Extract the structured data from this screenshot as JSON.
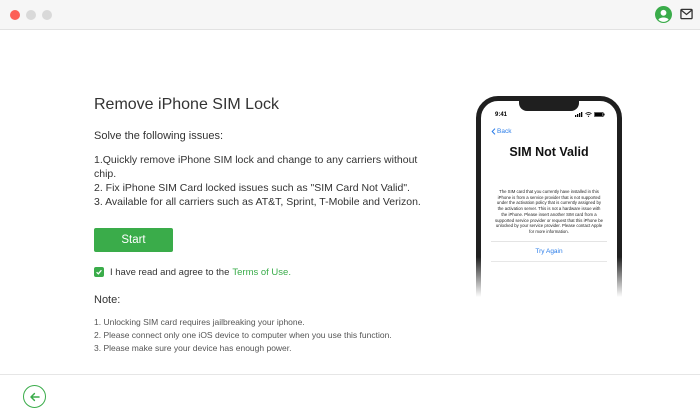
{
  "header": {
    "window_controls": [
      "close",
      "minimize",
      "maximize"
    ],
    "right_icons": [
      "user-icon",
      "mail-icon"
    ]
  },
  "main": {
    "title": "Remove iPhone SIM Lock",
    "subtitle": "Solve the following issues:",
    "issues": [
      "1.Quickly remove iPhone SIM lock and change to any carriers without chip.",
      "2. Fix iPhone SIM Card locked issues such as \"SIM Card Not Valid\".",
      "3. Available for all carriers such as AT&T, Sprint, T-Mobile and Verizon."
    ],
    "start_label": "Start",
    "agreement": {
      "checked": true,
      "text": "I have read and agree to the",
      "link": "Terms of Use."
    },
    "note_title": "Note:",
    "notes": [
      "1. Unlocking SIM card requires jailbreaking your iphone.",
      "2. Please connect only one iOS device to computer when you use this function.",
      "3. Please make sure your device has enough power."
    ]
  },
  "phone": {
    "time": "9:41",
    "back_label": "Back",
    "heading": "SIM Not Valid",
    "body": "The SIM card that you currently have installed in this iPhone is from a service provider that is not supported under the activation policy that is currently assigned by the activation server. This is not a hardware issue with the iPhone. Please insert another SIM card from a supported service provider or request that this iPhone be unlocked by your service provider. Please contact Apple for more information.",
    "action": "Try Again"
  },
  "footer": {
    "back_icon": "arrow-left-icon"
  },
  "colors": {
    "accent": "#3aac4a",
    "link_blue": "#2b7de9",
    "close_red": "#fc5f57"
  }
}
